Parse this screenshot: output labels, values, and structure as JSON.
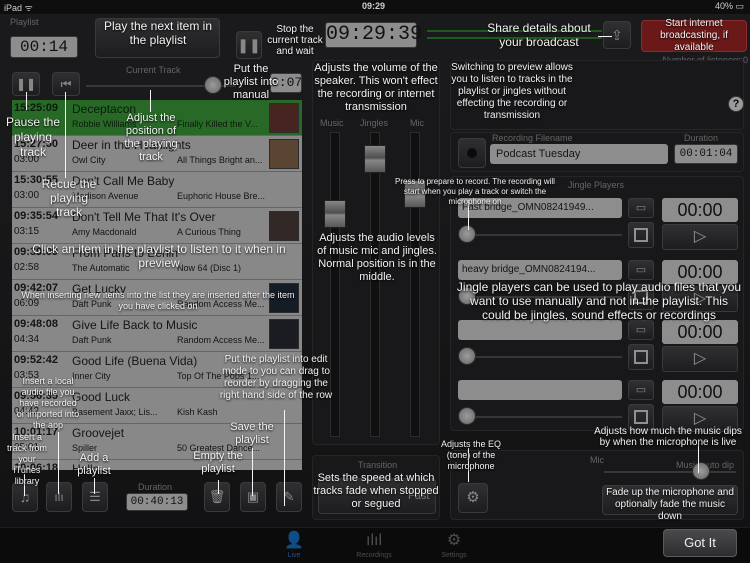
{
  "status_bar": {
    "carrier": "iPad ᯤ",
    "time": "09:29",
    "battery": "40% ▭"
  },
  "header": {
    "playlist_label": "Playlist",
    "playlist_timer": "00:14",
    "clock": "09:29:39",
    "listeners": "Number of listeners:0"
  },
  "current_track_label": "Current Track",
  "current_track_time": "3:07",
  "playlist": {
    "rows": [
      {
        "t1": "15:25:09",
        "t2": "02:34",
        "title": "Deceptacon",
        "artist": "Robbie Williams",
        "album": "Finally Killed the V...",
        "playing": true
      },
      {
        "t1": "15:27:50",
        "t2": "03:00",
        "title": "Deer in the Headlights",
        "artist": "Owl City",
        "album": "All Things Bright an...",
        "playing": false
      },
      {
        "t1": "15:30:55",
        "t2": "03:00",
        "title": "Don't Call Me Baby",
        "artist": "Madison Avenue",
        "album": "Euphoric House Bre...",
        "playing": false
      },
      {
        "t1": "09:35:54",
        "t2": "03:15",
        "title": "Don't Tell Me That It's Over",
        "artist": "Amy Macdonald",
        "album": "A Curious Thing",
        "playing": false
      },
      {
        "t1": "09:39:09",
        "t2": "02:58",
        "title": "From Paris to Berlin",
        "artist": "The Automatic",
        "album": "Now 64 (Disc 1)",
        "playing": false
      },
      {
        "t1": "09:42:07",
        "t2": "06:09",
        "title": "Get Lucky",
        "artist": "Daft Punk",
        "album": "Random Access Me...",
        "playing": false
      },
      {
        "t1": "09:48:08",
        "t2": "04:34",
        "title": "Give Life Back to Music",
        "artist": "Daft Punk",
        "album": "Random Access Me...",
        "playing": false
      },
      {
        "t1": "09:52:42",
        "t2": "03:53",
        "title": "Good Life (Buena Vida)",
        "artist": "Inner City",
        "album": "Top Of The Pops 1...",
        "playing": false
      },
      {
        "t1": "09:56:35",
        "t2": "04:42",
        "title": "Good Luck",
        "artist": "Basement Jaxx; Lis...",
        "album": "Kish Kash",
        "playing": false
      },
      {
        "t1": "10:01:17",
        "t2": "05:01",
        "title": "Groovejet",
        "artist": "Spiller",
        "album": "50 Greatest Dance...",
        "playing": false
      },
      {
        "t1": "10:06:18",
        "t2": "03:08",
        "title": "Hello",
        "artist": "",
        "album": "",
        "playing": false
      }
    ]
  },
  "playlist_footer": {
    "duration_label": "Duration",
    "duration_value": "00:40:13"
  },
  "mixer": {
    "labels": [
      "Music",
      "Jingles",
      "Mic"
    ],
    "transition_label": "Transition",
    "slider_label": "Fast"
  },
  "recording": {
    "label": "Recording Filename",
    "duration_label": "Duration",
    "filename": "Podcast Tuesday",
    "duration": "00:01:04"
  },
  "jingles": {
    "label": "Jingle Players",
    "players": [
      {
        "name": "Fast bridge_OMN08241949...",
        "time": "00:00"
      },
      {
        "name": "heavy bridge_OMN0824194...",
        "time": "00:00"
      },
      {
        "name": "",
        "time": "00:00"
      },
      {
        "name": "",
        "time": "00:00"
      }
    ]
  },
  "mic": {
    "label": "Mic",
    "autodip_label": "Music auto dip"
  },
  "got_it": "Got It",
  "tabs": [
    {
      "label": "Live",
      "icon": "person-icon"
    },
    {
      "label": "Recordings",
      "icon": "waveform-icon"
    },
    {
      "label": "Settings",
      "icon": "gear-icon"
    }
  ],
  "overlays": {
    "play_next": "Play the next item in the playlist",
    "stop_current": "Stop the current track and wait",
    "manual": "Put the playlist into manual",
    "speaker_volume": "Adjusts the volume of the speaker. This won't effect the recording or internet transmission",
    "preview": "Switching to preview allows you to listen to tracks in the playlist or jingles without effecting the recording or transmission",
    "share": "Share details about your broadcast",
    "start_broadcast": "Start internet broadcasting, if available",
    "pause": "Pause the playing track",
    "position": "Adjust the position of the playing track",
    "recue": "Recue the playing track",
    "click_item": "Click an item in the playlist to listen to it when in preview",
    "insert_new": "When inserting new items into the list they are inserted after the item you have clicked on",
    "edit_mode": "Put the playlist into edit mode to you can drag to reorder by dragging the right hand side of the row",
    "local_audio": "Insert a local audio file you have recorded or imported into the app",
    "itunes": "Insert a track from your iTunes library",
    "add_playlist": "Add a playlist",
    "empty": "Empty the playlist",
    "save": "Save the playlist",
    "audio_levels": "Adjusts the audio levels of music mic and jingles. Normal position is in the middle.",
    "record": "Press to prepare to record. The recording will start when you play a track or switch the microphone on",
    "jingle_help": "Jingle players can be used to play audio files that you want to use manually and not in the playlist. This could be jingles, sound effects or recordings",
    "fade_speed": "Sets the speed at which tracks fade when stopped or segued",
    "eq": "Adjusts the EQ (tone) of the microphone",
    "dips": "Adjusts how much the music dips by when the microphone is live",
    "fade_up": "Fade up the microphone and optionally fade the music down"
  }
}
